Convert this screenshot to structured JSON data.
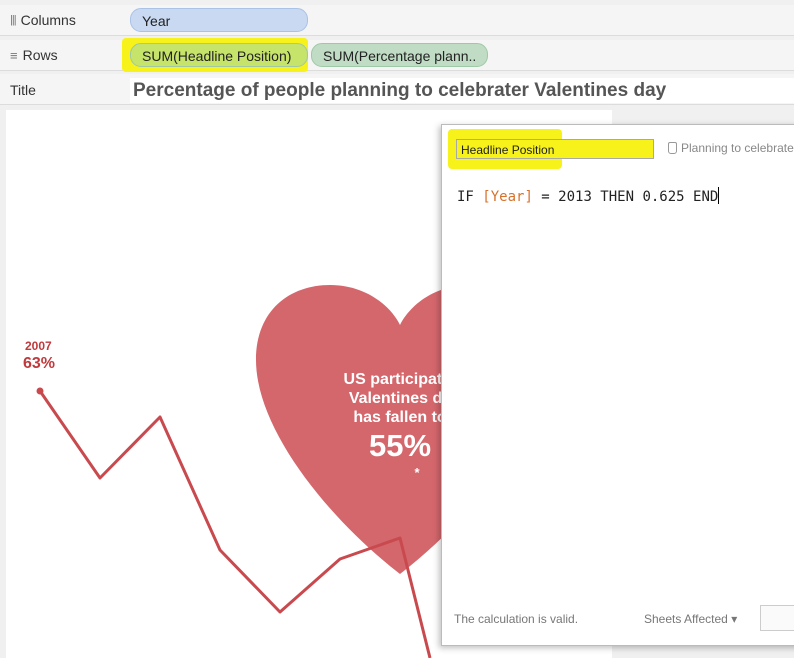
{
  "shelves": {
    "columns": {
      "label": "Columns",
      "pills": [
        "Year"
      ]
    },
    "rows": {
      "label": "Rows",
      "pills": [
        "SUM(Headline Position)",
        "SUM(Percentage plann.."
      ]
    }
  },
  "title_shelf": {
    "label": "Title",
    "text": "Percentage of people planning to celebrater Valentines day"
  },
  "chart": {
    "first_point_year": "2007",
    "first_point_value": "63%",
    "heart_lines": [
      "US participatio",
      "Valentines da",
      "has fallen to"
    ],
    "heart_big": "55%",
    "heart_note": "*",
    "colors": {
      "heart": "#d4676c",
      "line": "#c94a4e",
      "label": "#c0393d",
      "highlight": "#f7f21a"
    }
  },
  "calc_editor": {
    "name": "Headline Position",
    "datasource": "Planning to celebrate",
    "code_prefix": "IF ",
    "code_field": "[Year]",
    "code_suffix": " = 2013 THEN 0.625 END",
    "status": "The calculation is valid.",
    "sheets_affected": "Sheets Affected",
    "sheets_arrow": "▾"
  }
}
